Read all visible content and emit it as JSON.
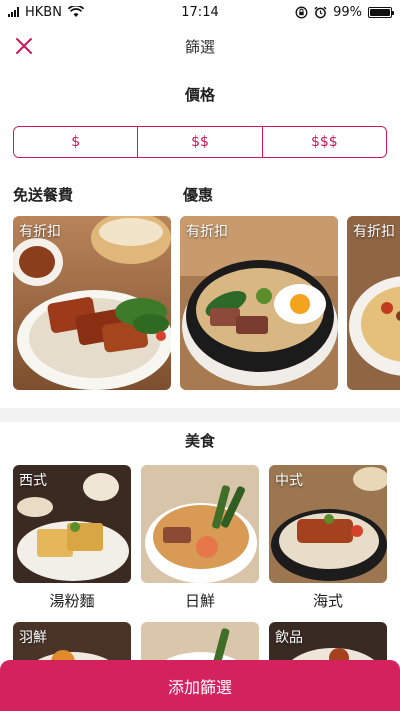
{
  "status_bar": {
    "carrier": "HKBN",
    "time": "17:14",
    "battery": "99%",
    "battery_level": 0.99
  },
  "header": {
    "title": "篩選"
  },
  "price": {
    "title": "價格",
    "options": [
      "$",
      "$$",
      "$$$"
    ]
  },
  "free_delivery": {
    "label": "免送餐費"
  },
  "promotions": {
    "label": "優惠",
    "cards": [
      {
        "badge": "有折扣"
      },
      {
        "badge": "有折扣"
      },
      {
        "badge": "有折扣"
      }
    ]
  },
  "cuisine": {
    "title": "美食",
    "items": [
      {
        "badge": "西式",
        "name": "湯粉麵"
      },
      {
        "badge": "",
        "name": "日鮮"
      },
      {
        "badge": "中式",
        "name": "海式"
      },
      {
        "badge": "羽鮮",
        "name": ""
      },
      {
        "badge": "",
        "name": ""
      },
      {
        "badge": "飲品",
        "name": ""
      }
    ]
  },
  "apply_button": {
    "label": "添加篩選"
  },
  "colors": {
    "accent": "#c8185a",
    "button_bg": "#d4225f"
  }
}
